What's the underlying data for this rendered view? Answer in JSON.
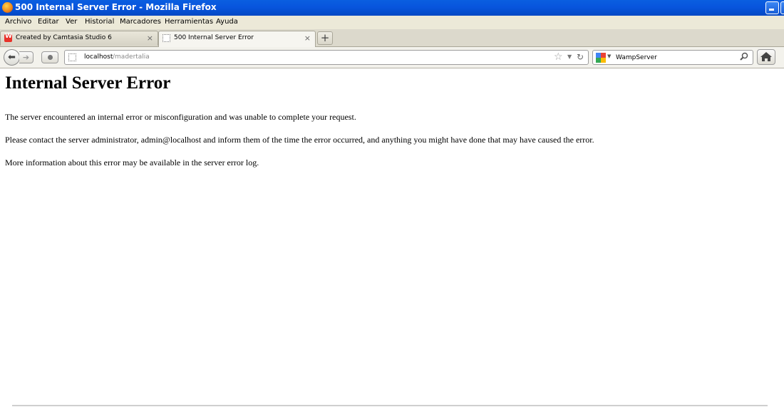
{
  "window": {
    "title": "500 Internal Server Error - Mozilla Firefox"
  },
  "menu": [
    "Archivo",
    "Editar",
    "Ver",
    "Historial",
    "Marcadores",
    "Herramientas",
    "Ayuda"
  ],
  "tabs": [
    {
      "label": "Created by Camtasia Studio 6",
      "active": false,
      "icon": "camtasia-icon"
    },
    {
      "label": "500 Internal Server Error",
      "active": true,
      "icon": "blank-page-icon"
    }
  ],
  "navigation": {
    "url_host": "localhost",
    "url_path": "/madertalia",
    "search_text": "WampServer"
  },
  "page": {
    "heading": "Internal Server Error",
    "paragraphs": [
      "The server encountered an internal error or misconfiguration and was unable to complete your request.",
      "Please contact the server administrator, admin@localhost and inform them of the time the error occurred, and anything you might have done that may have caused the error.",
      "More information about this error may be available in the server error log."
    ]
  },
  "colors": {
    "titlebar": "#0855dd",
    "chrome": "#ece9d8",
    "camtasia_red": "#e8322a"
  }
}
